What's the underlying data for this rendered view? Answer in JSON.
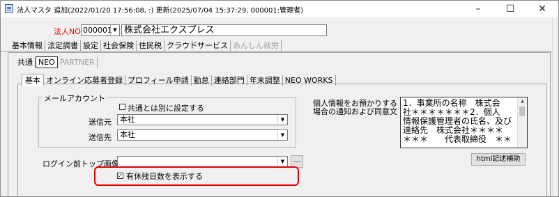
{
  "window": {
    "title": "法人マスタ 追加(2022/01/20 17:56:08, :) 更新(2025/07/04 15:37:29, 000001:管理者)",
    "minimize_glyph": "–",
    "maximize_glyph": "☐",
    "close_glyph": "✕"
  },
  "corp": {
    "no_label": "法人NO",
    "code_value": "000001",
    "name_value": "株式会社エクスプレス"
  },
  "top_tabs": [
    "基本情報",
    "法定調書",
    "設定",
    "社会保険",
    "住民税",
    "クラウドサービス",
    "あんしん就労"
  ],
  "cloud_tabs": [
    "共通",
    "NEO",
    "PARTNER"
  ],
  "neo_tabs": [
    "基本",
    "オンライン応募者登録",
    "プロフィール申請",
    "勤怠",
    "連絡部門",
    "年末調整",
    "NEO WORKS"
  ],
  "mail": {
    "group_title": "メールアカウント",
    "separate_check_label": "共通とは別に設定する",
    "sender_label": "送信元",
    "sender_value": "本社",
    "recipient_label": "送信先",
    "recipient_value": "本社"
  },
  "login": {
    "image_label": "ログイン前トップ画像",
    "browse_label": "..."
  },
  "paid_leave": {
    "checked": true,
    "label": "有休残日数を表示する"
  },
  "privacy": {
    "label_line1": "個人情報をお預かりする",
    "label_line2": "場合の通知および同意文",
    "text_lines": [
      "1．事業所の名称　株式会",
      "社＊＊＊＊＊＊＊2．個人",
      "情報保護管理者の氏名、及び",
      "連絡先　株式会社＊＊＊＊",
      "＊＊＊　　代表取締役　＊＊"
    ],
    "html_helper_label": "html記述補助"
  }
}
